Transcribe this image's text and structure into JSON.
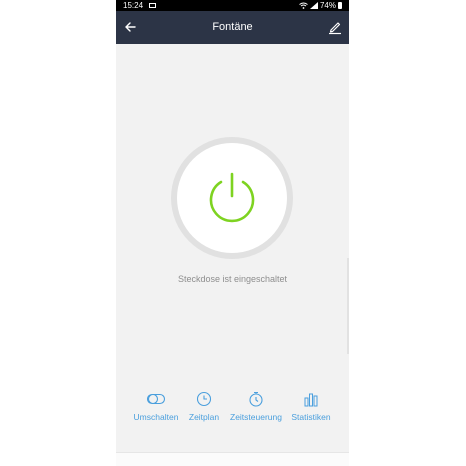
{
  "status_bar": {
    "time": "15:24",
    "battery": "74%"
  },
  "header": {
    "title": "Fontäne",
    "back_icon": "arrow-left-icon",
    "edit_icon": "pencil-icon",
    "background": "#2c3446"
  },
  "device": {
    "state_text": "Steckdose ist eingeschaltet",
    "power_icon": "power-icon",
    "power_color": "#7ed321"
  },
  "nav": {
    "accent": "#4a9fdd",
    "items": [
      {
        "label": "Umschalten",
        "icon": "toggle-icon"
      },
      {
        "label": "Zeitplan",
        "icon": "clock-icon"
      },
      {
        "label": "Zeitsteuerung",
        "icon": "timer-icon"
      },
      {
        "label": "Statistiken",
        "icon": "bar-chart-icon"
      }
    ]
  }
}
